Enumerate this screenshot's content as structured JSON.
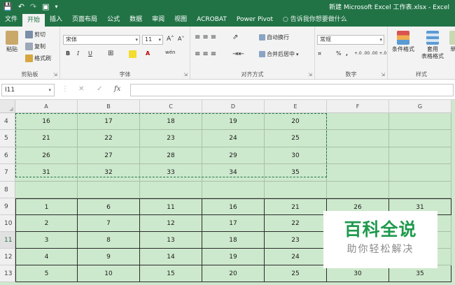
{
  "title_bar": {
    "window_title": "新建 Microsoft Excel 工作表.xlsx - Excel"
  },
  "tabs": [
    "文件",
    "开始",
    "插入",
    "页面布局",
    "公式",
    "数据",
    "审阅",
    "视图",
    "ACROBAT",
    "Power Pivot"
  ],
  "active_tab": "开始",
  "tell_me": "告诉我你想要做什么",
  "ribbon": {
    "clipboard": {
      "paste": "粘贴",
      "cut": "剪切",
      "copy": "复制",
      "format_painter": "格式刷",
      "group": "剪贴板"
    },
    "font": {
      "name": "宋体",
      "size": "11",
      "grow": "A˄",
      "shrink": "A˅",
      "bold": "B",
      "italic": "I",
      "underline": "U",
      "wen": "wén",
      "group": "字体"
    },
    "alignment": {
      "wrap": "自动换行",
      "merge": "合并后居中",
      "group": "对齐方式"
    },
    "number": {
      "format": "常规",
      "percent": "%",
      "comma": ",",
      "inc_dec": "+.0 .00",
      "dec_dec": ".00 +.0",
      "group": "数字"
    },
    "styles": {
      "cond": "条件格式",
      "table": "套用\n表格格式",
      "cell": "单",
      "group": "样式"
    }
  },
  "formula_bar": {
    "name_box": "I11",
    "cancel": "✕",
    "enter": "✓",
    "fx": "fx"
  },
  "columns": [
    "A",
    "B",
    "C",
    "D",
    "E",
    "F",
    "G"
  ],
  "rows": [
    {
      "num": "4",
      "cells": [
        "16",
        "17",
        "18",
        "19",
        "20",
        "",
        ""
      ]
    },
    {
      "num": "5",
      "cells": [
        "21",
        "22",
        "23",
        "24",
        "25",
        "",
        ""
      ]
    },
    {
      "num": "6",
      "cells": [
        "26",
        "27",
        "28",
        "29",
        "30",
        "",
        ""
      ]
    },
    {
      "num": "7",
      "cells": [
        "31",
        "32",
        "33",
        "34",
        "35",
        "",
        ""
      ]
    },
    {
      "num": "8",
      "cells": [
        "",
        "",
        "",
        "",
        "",
        "",
        ""
      ]
    },
    {
      "num": "9",
      "cells": [
        "1",
        "6",
        "11",
        "16",
        "21",
        "26",
        "31"
      ]
    },
    {
      "num": "10",
      "cells": [
        "2",
        "7",
        "12",
        "17",
        "22",
        "",
        ""
      ]
    },
    {
      "num": "11",
      "cells": [
        "3",
        "8",
        "13",
        "18",
        "23",
        "",
        ""
      ]
    },
    {
      "num": "12",
      "cells": [
        "4",
        "9",
        "14",
        "19",
        "24",
        "",
        ""
      ]
    },
    {
      "num": "13",
      "cells": [
        "5",
        "10",
        "15",
        "20",
        "25",
        "30",
        "35"
      ]
    }
  ],
  "selected_row": "11",
  "watermark": {
    "line1": "百科全说",
    "line2": "助你轻松解决"
  },
  "colors": {
    "excel_green": "#217346",
    "sheet_fill": "#cde9cd",
    "watermark_green": "#1f9a4d"
  }
}
